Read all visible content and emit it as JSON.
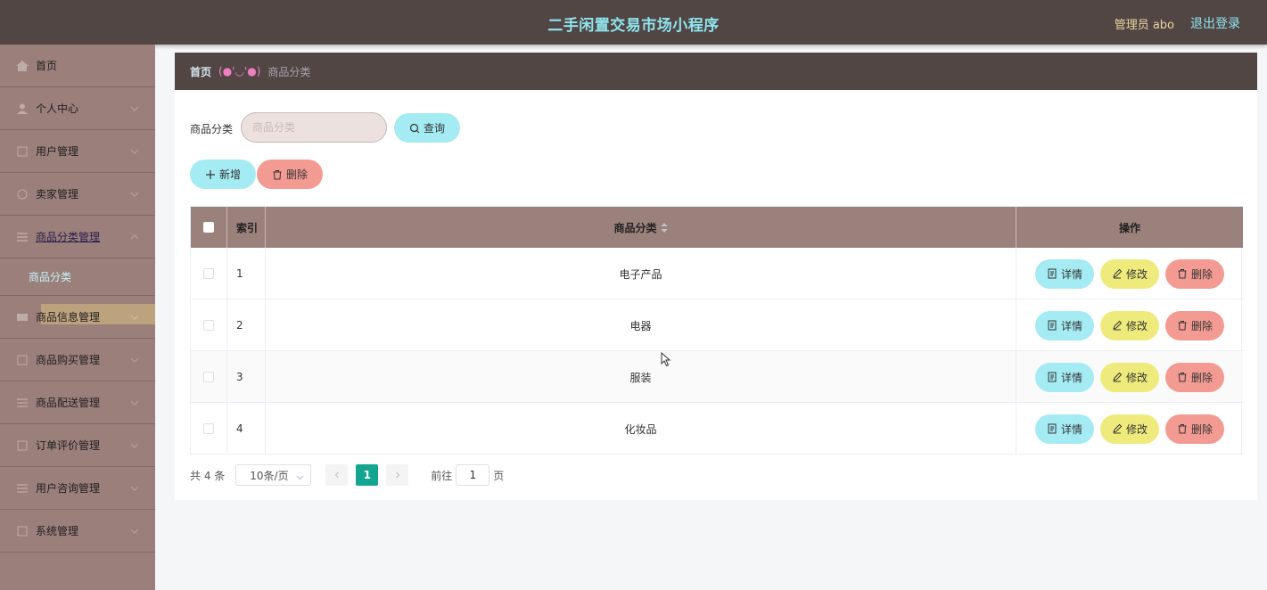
{
  "header": {
    "app_title": "二手闲置交易市场小程序",
    "admin_label": "管理员 abo",
    "logout_label": "退出登录"
  },
  "sidebar": {
    "items": [
      {
        "label": "首页",
        "icon": "home-icon"
      },
      {
        "label": "个人中心",
        "icon": "user-icon"
      },
      {
        "label": "用户管理",
        "icon": "users-icon"
      },
      {
        "label": "卖家管理",
        "icon": "seller-icon"
      },
      {
        "label": "商品分类管理",
        "icon": "category-icon"
      },
      {
        "label": "商品分类",
        "icon": ""
      },
      {
        "label": "商品信息管理",
        "icon": "goods-icon"
      },
      {
        "label": "商品购买管理",
        "icon": "cart-icon"
      },
      {
        "label": "商品配送管理",
        "icon": "delivery-icon"
      },
      {
        "label": "订单评价管理",
        "icon": "review-icon"
      },
      {
        "label": "用户咨询管理",
        "icon": "consult-icon"
      },
      {
        "label": "系统管理",
        "icon": "system-icon"
      }
    ]
  },
  "breadcrumb": {
    "home": "首页",
    "separator": "(●'◡'●)",
    "current": "商品分类"
  },
  "search": {
    "label": "商品分类",
    "placeholder": "商品分类",
    "value": "",
    "query_label": "查询"
  },
  "toolbar": {
    "add_label": "新增",
    "delete_label": "删除"
  },
  "table": {
    "columns": {
      "index": "索引",
      "name": "商品分类",
      "ops": "操作"
    },
    "rows": [
      {
        "index": "1",
        "name": "电子产品"
      },
      {
        "index": "2",
        "name": "电器"
      },
      {
        "index": "3",
        "name": "服装"
      },
      {
        "index": "4",
        "name": "化妆品"
      }
    ],
    "ops": {
      "detail": "详情",
      "edit": "修改",
      "delete": "删除"
    }
  },
  "pagination": {
    "total": "共 4 条",
    "page_size": "10条/页",
    "current_page": "1",
    "goto_prefix": "前往",
    "goto_value": "1",
    "goto_suffix": "页"
  },
  "colors": {
    "topbar": "#524645",
    "sidebar": "#9b7f7a",
    "accent_cyan": "#a4ebf3",
    "accent_yellow": "#eeeb7c",
    "accent_red": "#f39b93",
    "page_active": "#14a591"
  }
}
